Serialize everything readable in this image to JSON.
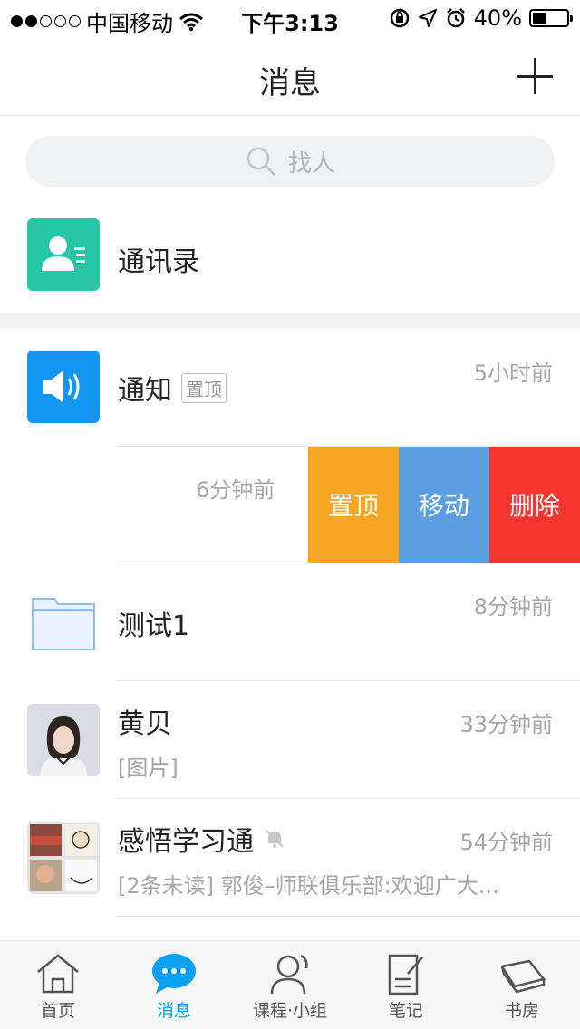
{
  "status_bar": {
    "carrier": "中国移动",
    "time": "下午3:13",
    "battery": "40%",
    "battery_level": 0.4,
    "signal_bars": 2
  },
  "nav": {
    "title": "消息"
  },
  "search": {
    "placeholder": "找人"
  },
  "contacts": {
    "label": "通讯录",
    "color": "#26c6a6"
  },
  "rows": [
    {
      "title": "通知",
      "tag": "置顶",
      "time": "5小时前",
      "icon": "speaker-icon",
      "color": "#1296f2"
    },
    {
      "title": "测试1",
      "time": "8分钟前",
      "icon": "folder-icon"
    },
    {
      "title": "黄贝",
      "time": "33分钟前",
      "subtitle": "[图片]",
      "icon": "avatar-photo"
    },
    {
      "title": "感悟学习通",
      "time": "54分钟前",
      "subtitle": "[2条未读] 郭俊–师联俱乐部:欢迎广大...",
      "icon": "group-avatar",
      "muted": true
    }
  ],
  "swiped_row": {
    "time": "6分钟前",
    "actions": [
      {
        "label": "置顶",
        "color": "#f5a623"
      },
      {
        "label": "移动",
        "color": "#5b9fe0"
      },
      {
        "label": "删除",
        "color": "#f43530"
      }
    ]
  },
  "tabs": [
    {
      "label": "首页",
      "icon": "home-icon",
      "active": false
    },
    {
      "label": "消息",
      "icon": "chat-bubble-icon",
      "active": true
    },
    {
      "label": "课程·小组",
      "icon": "person-icon",
      "active": false
    },
    {
      "label": "笔记",
      "icon": "note-icon",
      "active": false
    },
    {
      "label": "书房",
      "icon": "book-icon",
      "active": false
    }
  ],
  "accent_color": "#0aa0f0"
}
